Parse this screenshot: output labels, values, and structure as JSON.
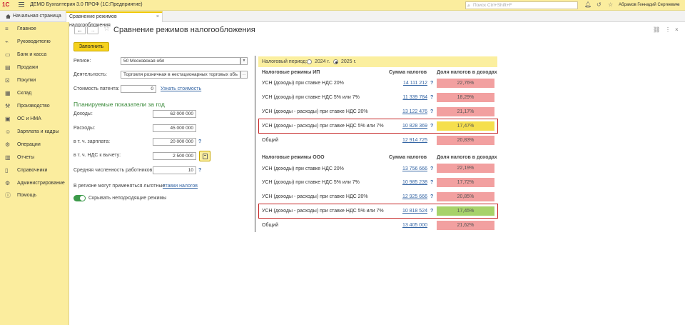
{
  "app": {
    "logo": "1С",
    "title": "ДЕМО Бухгалтерия 3.0 ПРОФ  (1С:Предприятие)",
    "search_placeholder": "Поиск Ctrl+Shift+F",
    "user": "Абрамов Геннадий Сергеевич"
  },
  "tabs": {
    "home": "Начальная страница",
    "active": "Сравнение режимов налогообложения",
    "close": "×"
  },
  "sidebar": {
    "items": [
      {
        "label": "Главное",
        "icon": "menu-icon"
      },
      {
        "label": "Руководителю",
        "icon": "chart-icon"
      },
      {
        "label": "Банк и касса",
        "icon": "bank-icon"
      },
      {
        "label": "Продажи",
        "icon": "sales-icon"
      },
      {
        "label": "Покупки",
        "icon": "cart-icon"
      },
      {
        "label": "Склад",
        "icon": "warehouse-icon"
      },
      {
        "label": "Производство",
        "icon": "factory-icon"
      },
      {
        "label": "ОС и НМА",
        "icon": "assets-icon"
      },
      {
        "label": "Зарплата и кадры",
        "icon": "people-icon"
      },
      {
        "label": "Операции",
        "icon": "operations-icon"
      },
      {
        "label": "Отчеты",
        "icon": "reports-icon"
      },
      {
        "label": "Справочники",
        "icon": "book-icon"
      },
      {
        "label": "Администрирование",
        "icon": "gear-icon"
      },
      {
        "label": "Помощь",
        "icon": "help-icon"
      }
    ]
  },
  "form": {
    "title": "Сравнение режимов налогообложения",
    "fill_button": "Заполнить",
    "region_label": "Регион:",
    "region_value": "50 Московская обл",
    "activity_label": "Деятельность:",
    "activity_value": "Торговля розничная в нестационарных торговых объ",
    "patent_label": "Стоимость патента:",
    "patent_value": "0",
    "patent_link": "Узнать стоимость",
    "planned_title": "Планируемые показатели за год",
    "income_label": "Доходы:",
    "income_value": "62 000 000",
    "expenses_label": "Расходы:",
    "expenses_value": "45 000 000",
    "salary_label": "в т. ч. зарплата:",
    "salary_value": "20 000 000",
    "vat_label": "в т. ч. НДС к вычету:",
    "vat_value": "2 500 000",
    "workers_label": "Средняя численность работников:",
    "workers_value": "10",
    "q": "?",
    "benefit_text": "В регионе могут применяться льготные",
    "benefit_link": "ставки налогов",
    "hide_toggle_label": "Скрывать неподходящие режимы"
  },
  "period": {
    "label": "Налоговый период:",
    "options": [
      "2024 г.",
      "2025 г."
    ],
    "selected": "2025 г."
  },
  "ip_table": {
    "header_regime": "Налоговые режимы ИП",
    "header_sum": "Сумма налогов",
    "header_share": "Доля налогов в доходах",
    "rows": [
      {
        "label": "УСН (доходы) при ставке НДС 20%",
        "sum": "14 111 212",
        "share": "22,76%",
        "color": "red"
      },
      {
        "label": "УСН (доходы) при ставке НДС 5% или 7%",
        "sum": "11 339 784",
        "share": "18,29%",
        "color": "red"
      },
      {
        "label": "УСН (доходы - расходы) при ставке НДС 20%",
        "sum": "13 122 476",
        "share": "21,17%",
        "color": "red"
      },
      {
        "label": "УСН (доходы - расходы) при ставке НДС 5% или 7%",
        "sum": "10 828 369",
        "share": "17,47%",
        "color": "yellow"
      },
      {
        "label": "Общий",
        "sum": "12 914 725",
        "share": "20,83%",
        "color": "red"
      }
    ]
  },
  "ooo_table": {
    "header_regime": "Налоговые режимы ООО",
    "header_sum": "Сумма налогов",
    "header_share": "Доля налогов в доходах",
    "rows": [
      {
        "label": "УСН (доходы) при ставке НДС 20%",
        "sum": "13 756 666",
        "share": "22,19%",
        "color": "red"
      },
      {
        "label": "УСН (доходы) при ставке НДС 5% или 7%",
        "sum": "10 985 238",
        "share": "17,72%",
        "color": "red"
      },
      {
        "label": "УСН (доходы - расходы) при ставке НДС 20%",
        "sum": "12 925 666",
        "share": "20,85%",
        "color": "red"
      },
      {
        "label": "УСН (доходы - расходы) при ставке НДС 5% или 7%",
        "sum": "10 818 524",
        "share": "17,45%",
        "color": "green"
      },
      {
        "label": "Общий",
        "sum": "13 405 000",
        "share": "21,62%",
        "color": "red"
      }
    ]
  },
  "colors": {
    "red": "#f2a0a0",
    "yellow": "#f5df4d",
    "green": "#a7d26a",
    "highlight": "#c62828",
    "accent": "#f5d11e"
  }
}
